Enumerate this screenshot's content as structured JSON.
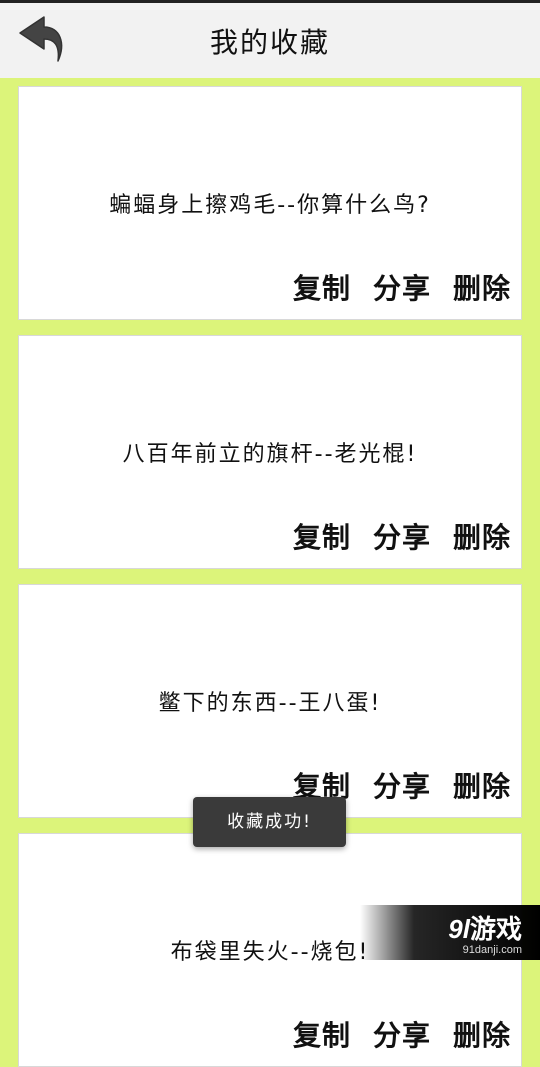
{
  "header": {
    "title": "我的收藏",
    "back_icon": "back-arrow-icon"
  },
  "colors": {
    "background": "#dcf47a",
    "header": "#f2f2f2",
    "card": "#ffffff",
    "toast": "#3a3a3a"
  },
  "favorites": [
    {
      "text": "蝙蝠身上擦鸡毛--你算什么鸟?",
      "copy": "复制",
      "share": "分享",
      "delete": "删除"
    },
    {
      "text": "八百年前立的旗杆--老光棍!",
      "copy": "复制",
      "share": "分享",
      "delete": "删除"
    },
    {
      "text": "鳖下的东西--王八蛋!",
      "copy": "复制",
      "share": "分享",
      "delete": "删除"
    },
    {
      "text": "布袋里失火--烧包!",
      "copy": "复制",
      "share": "分享",
      "delete": "删除"
    }
  ],
  "toast": {
    "message": "收藏成功!"
  },
  "watermark": {
    "logo_num": "9l",
    "logo_text": "游戏",
    "url": "91danji.com"
  }
}
